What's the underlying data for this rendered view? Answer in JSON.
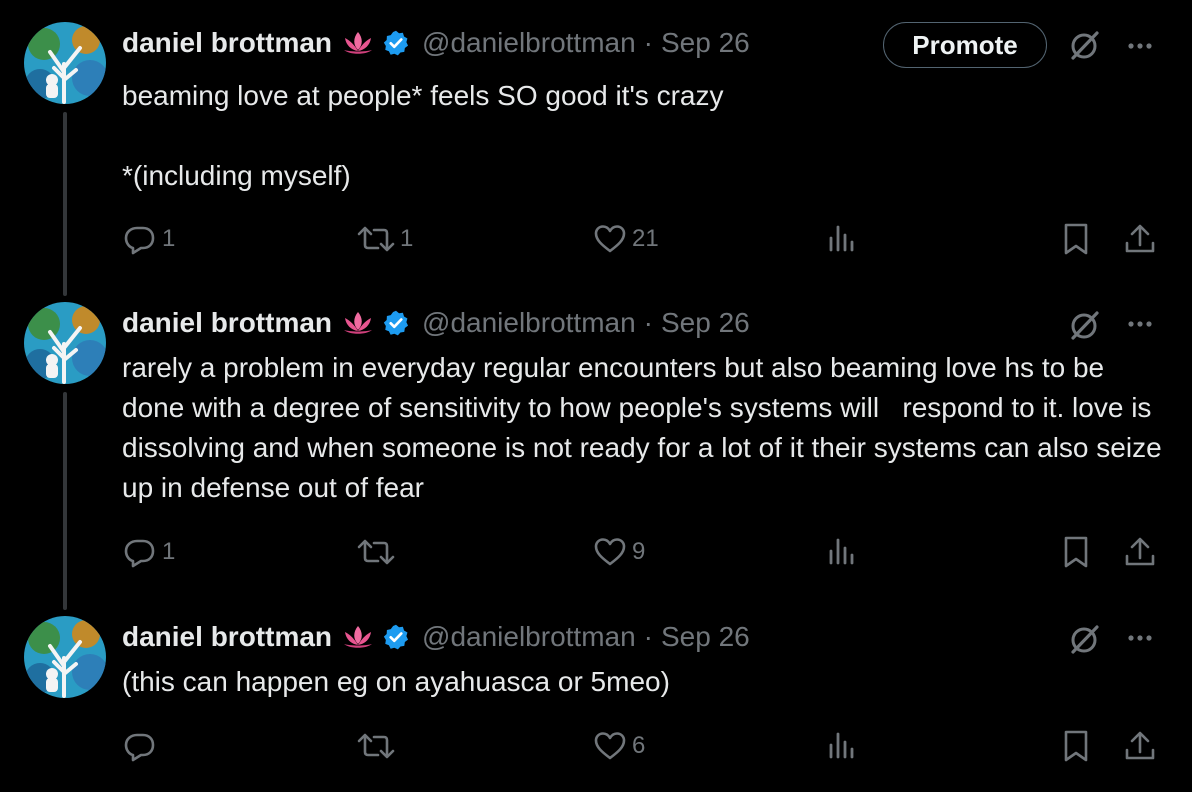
{
  "tweets": [
    {
      "author": "daniel brottman",
      "handle": "@danielbrottman",
      "separator": "·",
      "date": "Sep 26",
      "text": "beaming love at people* feels SO good it's crazy\n\n*(including myself)",
      "replies": "1",
      "retweets": "1",
      "likes": "21",
      "show_promote": true
    },
    {
      "author": "daniel brottman",
      "handle": "@danielbrottman",
      "separator": "·",
      "date": "Sep 26",
      "text": "rarely a problem in everyday regular encounters but also beaming love hs to be done with a degree of sensitivity to how people's systems will   respond to it. love is dissolving and when someone is not ready for a lot of it their systems can also seize up in defense out of fear",
      "replies": "1",
      "retweets": "",
      "likes": "9",
      "show_promote": false
    },
    {
      "author": "daniel brottman",
      "handle": "@danielbrottman",
      "separator": "·",
      "date": "Sep 26",
      "text": "(this can happen eg on ayahuasca or 5meo)",
      "replies": "",
      "retweets": "",
      "likes": "6",
      "show_promote": false
    }
  ],
  "promote_label": "Promote",
  "icons": {
    "emoji": "lotus-icon",
    "verified": "verified-badge-icon",
    "grok": "grok-icon",
    "more": "more-icon",
    "reply": "reply-icon",
    "retweet": "retweet-icon",
    "like": "like-icon",
    "views": "views-icon",
    "bookmark": "bookmark-icon",
    "share": "share-icon"
  },
  "colors": {
    "background": "#000000",
    "text": "#e7e9ea",
    "muted": "#71767b",
    "verified": "#1d9bf0",
    "thread_line": "#333639"
  }
}
